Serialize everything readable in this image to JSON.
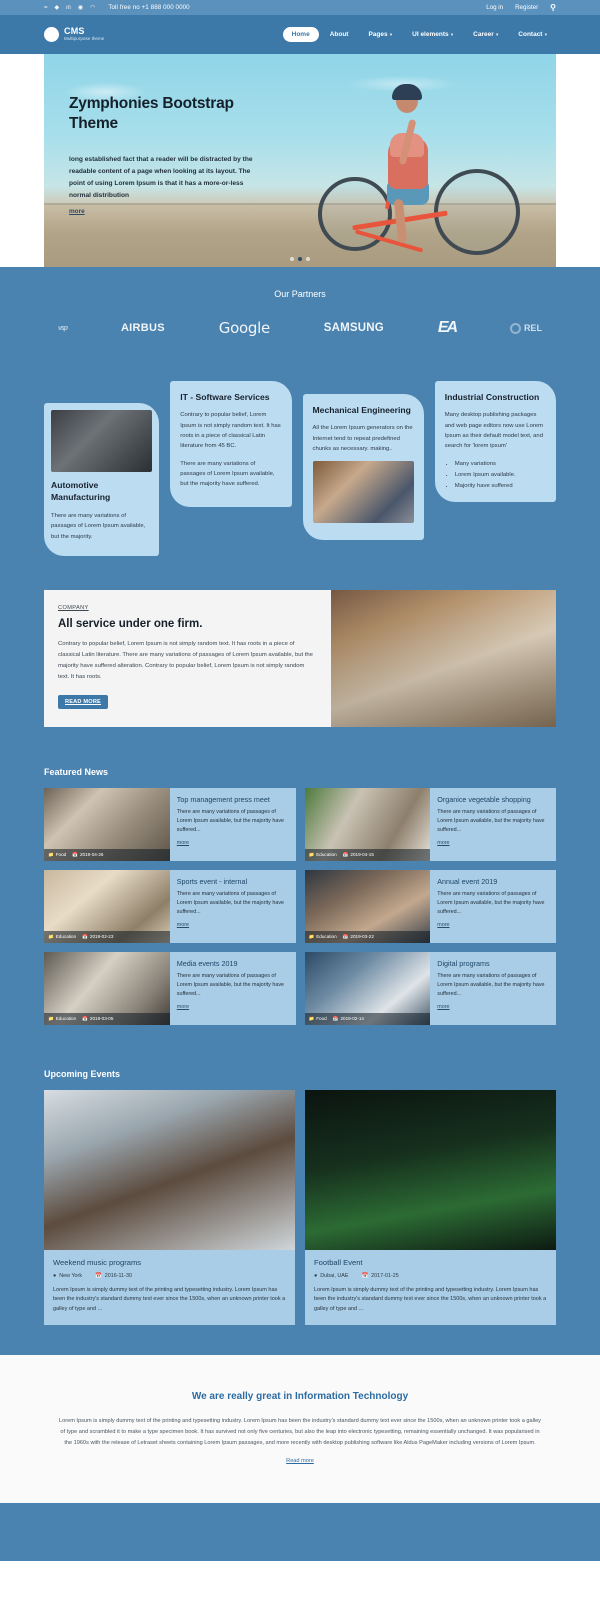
{
  "topbar": {
    "social": [
      "f",
      "t",
      "in",
      "g",
      "rss"
    ],
    "phone": "Toll free no +1 888 000 0000",
    "login": "Log in",
    "register": "Register",
    "search_icon": "search-icon"
  },
  "header": {
    "brand_name": "CMS",
    "brand_tagline": "Multipurpose theme",
    "nav": [
      {
        "label": "Home",
        "active": true,
        "caret": false
      },
      {
        "label": "About",
        "active": false,
        "caret": false
      },
      {
        "label": "Pages",
        "active": false,
        "caret": true
      },
      {
        "label": "UI elements",
        "active": false,
        "caret": true
      },
      {
        "label": "Career",
        "active": false,
        "caret": true
      },
      {
        "label": "Contact",
        "active": false,
        "caret": true
      }
    ]
  },
  "hero": {
    "title": "Zymphonies Bootstrap Theme",
    "body": "long established fact that a reader will be distracted by the readable content of a page when looking at its layout. The point of using Lorem Ipsum is that it has a more-or-less normal distribution",
    "more": "more",
    "slides": 3,
    "active_slide": 2
  },
  "partners": {
    "title": "Our Partners",
    "logos": [
      "vsp",
      "AIRBUS",
      "Google",
      "SAMSUNG",
      "EA",
      "REL"
    ]
  },
  "services": [
    {
      "title": "Automotive Manufacturing",
      "body": "There are many variations of passages of Lorem Ipsum available, but the majority.",
      "has_image": true,
      "image_name": "car-interior-photo"
    },
    {
      "title": "IT - Software Services",
      "body": "Contrary to popular belief, Lorem Ipsum is not simply random text. It has roots in a piece of classical Latin literature from 45 BC.",
      "body2": "There are many variations of passages of Lorem Ipsum available, but the majority have suffered.",
      "has_image": false
    },
    {
      "title": "Mechanical Engineering",
      "body": "All the Lorem Ipsum generators on the Internet tend to repeat predefined chunks as necessary. making..",
      "has_image": true,
      "image_name": "mechanic-photo"
    },
    {
      "title": "Industrial Construction",
      "body": "Many desktop publishing packages and web page editors now use Lorem Ipsum as their default model text, and search for 'lorem ipsum'",
      "bullets": [
        "Many variations",
        "Lorem Ipsum available.",
        "Majority have suffered"
      ],
      "has_image": false
    }
  ],
  "company": {
    "eyebrow": "COMPANY",
    "title": "All service under one firm.",
    "body": "Contrary to popular belief, Lorem Ipsum is not simply random text. It has roots in a piece of classical Latin literature. There are many variations of passages of Lorem Ipsum available, but the majority have suffered alteration. Contrary to popular belief, Lorem Ipsum is not simply random text. It has roots.",
    "button": "READ MORE",
    "image_name": "office-workspace-photo"
  },
  "news": {
    "title": "Featured News",
    "items": [
      {
        "title": "Top management press meet",
        "body": "There are many variations of passages of Lorem Ipsum available, but the majority have suffered...",
        "more": "more",
        "category": "Food",
        "date": "2019-04-26",
        "thumb": "newspapers-photo"
      },
      {
        "title": "Organice vegetable shopping",
        "body": "There are many variations of passages of Lorem Ipsum available, but the majority have suffered...",
        "more": "more",
        "category": "Education",
        "date": "2019-04-15",
        "thumb": "vegetables-photo"
      },
      {
        "title": "Sports event - internal",
        "body": "There are many variations of passages of Lorem Ipsum available, but the majority have suffered...",
        "more": "more",
        "category": "Education",
        "date": "2019-02-23",
        "thumb": "desk-tools-photo"
      },
      {
        "title": "Annual event 2019",
        "body": "There are many variations of passages of Lorem Ipsum available, but the majority have suffered...",
        "more": "more",
        "category": "Education",
        "date": "2019-03-22",
        "thumb": "speaker-photo"
      },
      {
        "title": "Media events 2019",
        "body": "There are many variations of passages of Lorem Ipsum available, but the majority have suffered...",
        "more": "more",
        "category": "Education",
        "date": "2019-03-05",
        "thumb": "daily-news-photo"
      },
      {
        "title": "Digital programs",
        "body": "There are many variations of passages of Lorem Ipsum available, but the majority have suffered...",
        "more": "more",
        "category": "Food",
        "date": "2019-02-14",
        "thumb": "tablet-photo"
      }
    ]
  },
  "events": {
    "title": "Upcoming Events",
    "items": [
      {
        "title": "Weekend music programs",
        "location": "New York",
        "date": "2016-11-30",
        "body": "Lorem Ipsum is simply dummy text of the printing and typesetting industry. Lorem Ipsum has been the industry's standard dummy text ever since the 1500s, when an unknown printer took a galley of type and ...",
        "image_name": "headphones-woman-photo"
      },
      {
        "title": "Football Event",
        "location": "Dubai, UAE",
        "date": "2017-01-25",
        "body": "Lorem Ipsum is simply dummy text of the printing and typesetting industry. Lorem Ipsum has been the industry's standard dummy text ever since the 1500s, when an unknown printer took a galley of type and ...",
        "image_name": "football-player-photo"
      }
    ]
  },
  "about": {
    "title": "We are really great in Information Technology",
    "body": "Lorem Ipsum is simply dummy text of the printing and typesetting industry. Lorem Ipsum has been the industry's standard dummy text ever since the 1500s, when an unknown printer took a galley of type and scrambled it to make a type specimen book. It has survived not only five centuries, but also the leap into electronic typesetting, remaining essentially unchanged. It was popularised in the 1960s with the release of Letraset sheets containing Lorem Ipsum passages, and more recently with desktop publishing software like Aldus PageMaker including versions of Lorem Ipsum.",
    "link": "Read more"
  },
  "colors": {
    "brand_blue": "#3c78a8",
    "section_blue": "#4a82b0",
    "topbar_blue": "#5b91bd",
    "card_blue": "#bcdcf2",
    "news_card_blue": "#a9cde6",
    "heading_blue": "#2d6ca2"
  }
}
